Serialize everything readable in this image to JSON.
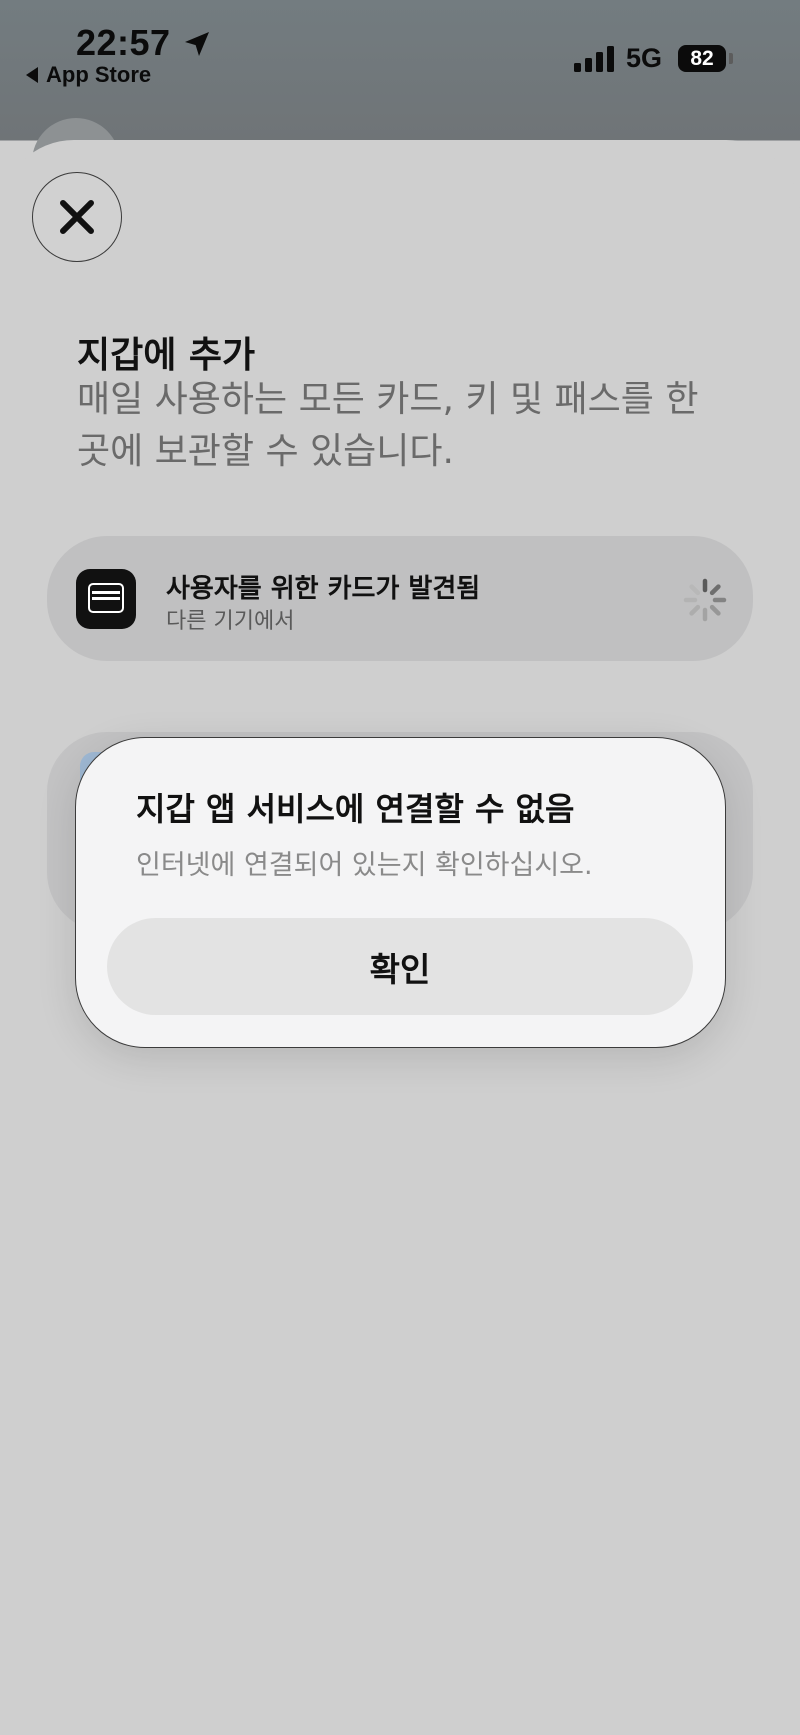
{
  "status_bar": {
    "time": "22:57",
    "back_app": "App Store",
    "network": "5G",
    "battery": "82"
  },
  "sheet": {
    "close_icon": "close-icon",
    "title": "지갑에 추가",
    "subtitle": "매일 사용하는 모든 카드, 키 및 패스를 한 곳에 보관할 수 있습니다.",
    "card_found": {
      "title": "사용자를 위한 카드가 발견됨",
      "subtitle": "다른 기기에서",
      "icon": "wallet-icon",
      "status_icon": "spinner-icon"
    }
  },
  "alert": {
    "title": "지갑 앱 서비스에 연결할 수 없음",
    "message": "인터넷에 연결되어 있는지 확인하십시오.",
    "confirm_label": "확인"
  },
  "colors": {
    "sheet_background": "#cfcfcf",
    "alert_background": "#f4f4f5",
    "button_background": "#e3e3e3"
  }
}
